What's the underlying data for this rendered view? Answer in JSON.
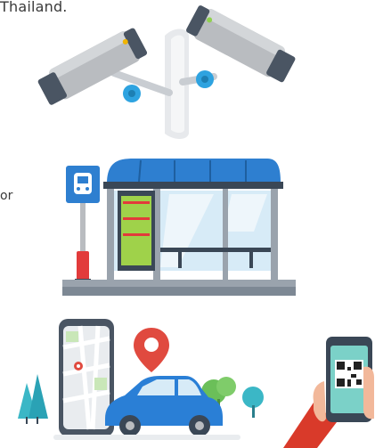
{
  "captions": {
    "top_fragment": "Thailand.",
    "side_fragment": "or"
  },
  "illustrations": [
    {
      "name": "cctv-camera-icon"
    },
    {
      "name": "bus-stop-icon"
    },
    {
      "name": "map-navigation-icon"
    },
    {
      "name": "qr-phone-icon"
    }
  ],
  "colors": {
    "camera_body": "#b9bcc0",
    "camera_dark": "#4a5563",
    "joint_blue": "#2ea3e0",
    "bus_blue": "#2e7fd0",
    "ad_green": "#9fd24a",
    "pole_red": "#e23b3b",
    "car_blue": "#2a7fd6",
    "pin_red": "#e04a3f",
    "tree_green": "#6bbf59",
    "sleeve_red": "#d93a2a"
  }
}
